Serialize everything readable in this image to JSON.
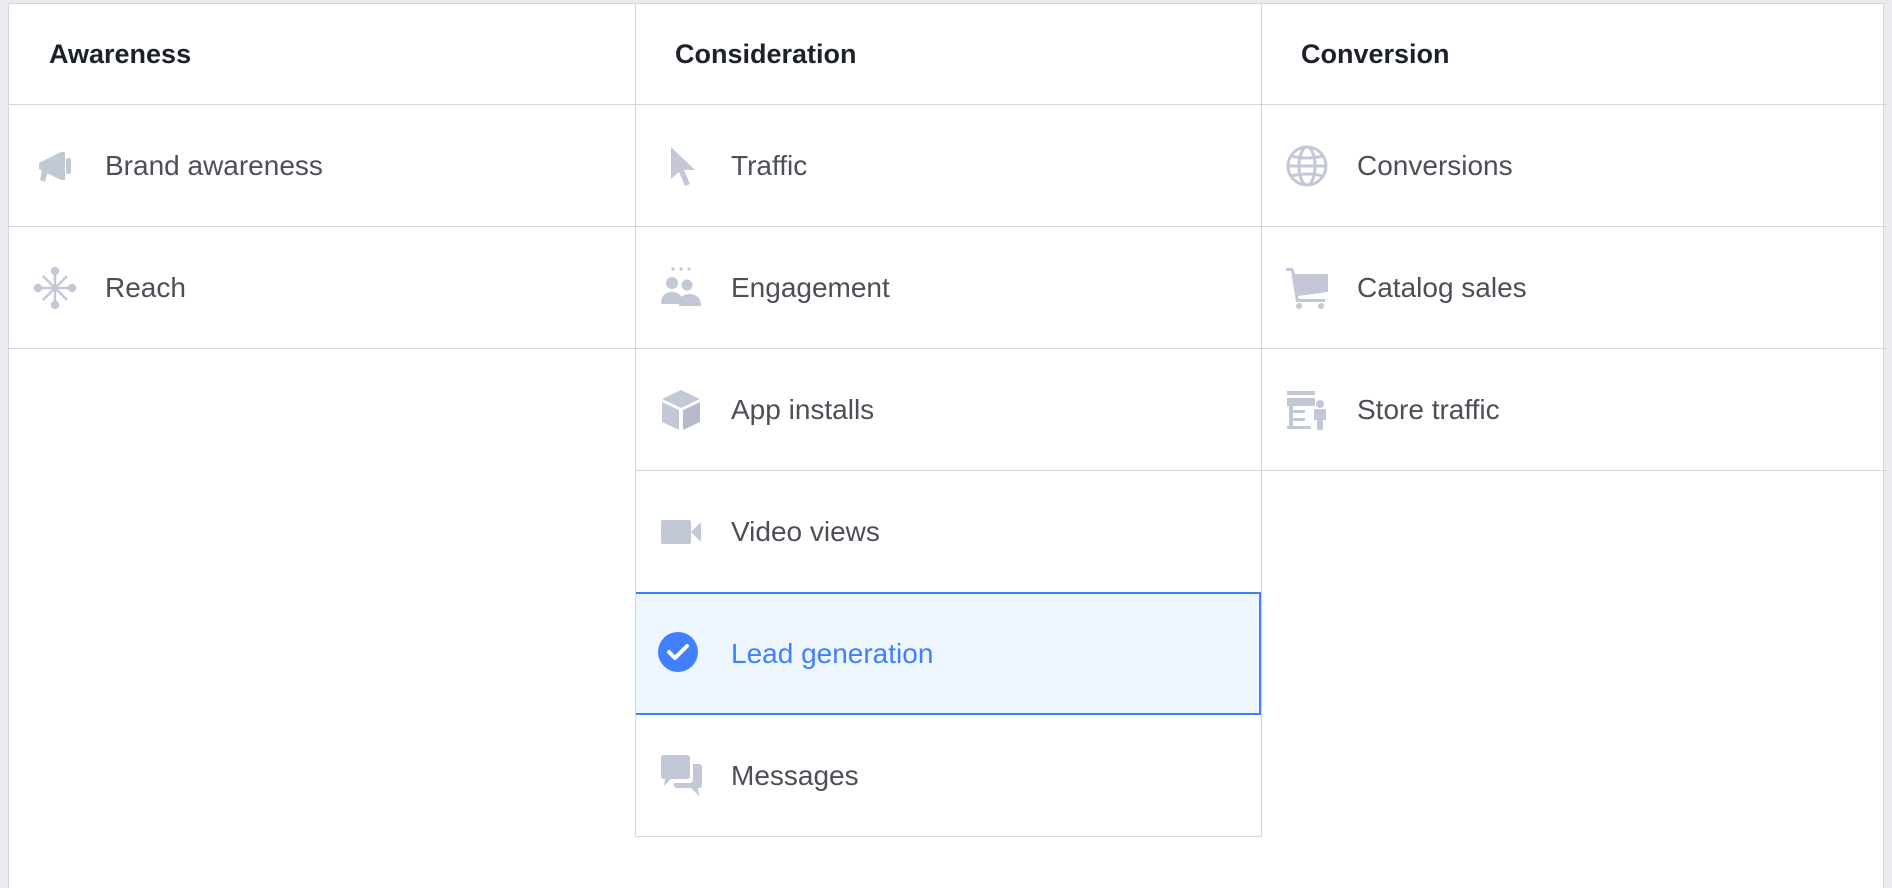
{
  "columns": [
    {
      "title": "Awareness",
      "items": [
        {
          "label": "Brand awareness",
          "icon": "megaphone-icon"
        },
        {
          "label": "Reach",
          "icon": "reach-network-icon"
        }
      ]
    },
    {
      "title": "Consideration",
      "items": [
        {
          "label": "Traffic",
          "icon": "cursor-icon"
        },
        {
          "label": "Engagement",
          "icon": "people-icon"
        },
        {
          "label": "App installs",
          "icon": "box-icon"
        },
        {
          "label": "Video views",
          "icon": "video-camera-icon"
        },
        {
          "label": "Lead generation",
          "icon": "check-circle-icon",
          "selected": true
        },
        {
          "label": "Messages",
          "icon": "chat-bubbles-icon"
        }
      ]
    },
    {
      "title": "Conversion",
      "items": [
        {
          "label": "Conversions",
          "icon": "globe-icon"
        },
        {
          "label": "Catalog sales",
          "icon": "shopping-cart-icon"
        },
        {
          "label": "Store traffic",
          "icon": "store-person-icon"
        }
      ]
    }
  ],
  "colors": {
    "icon": "#c3c8d6",
    "accent": "#4080ff",
    "selected_bg": "#edf5ff",
    "text": "#4b4f56",
    "header_text": "#1d2129",
    "border": "#d4d6da"
  }
}
